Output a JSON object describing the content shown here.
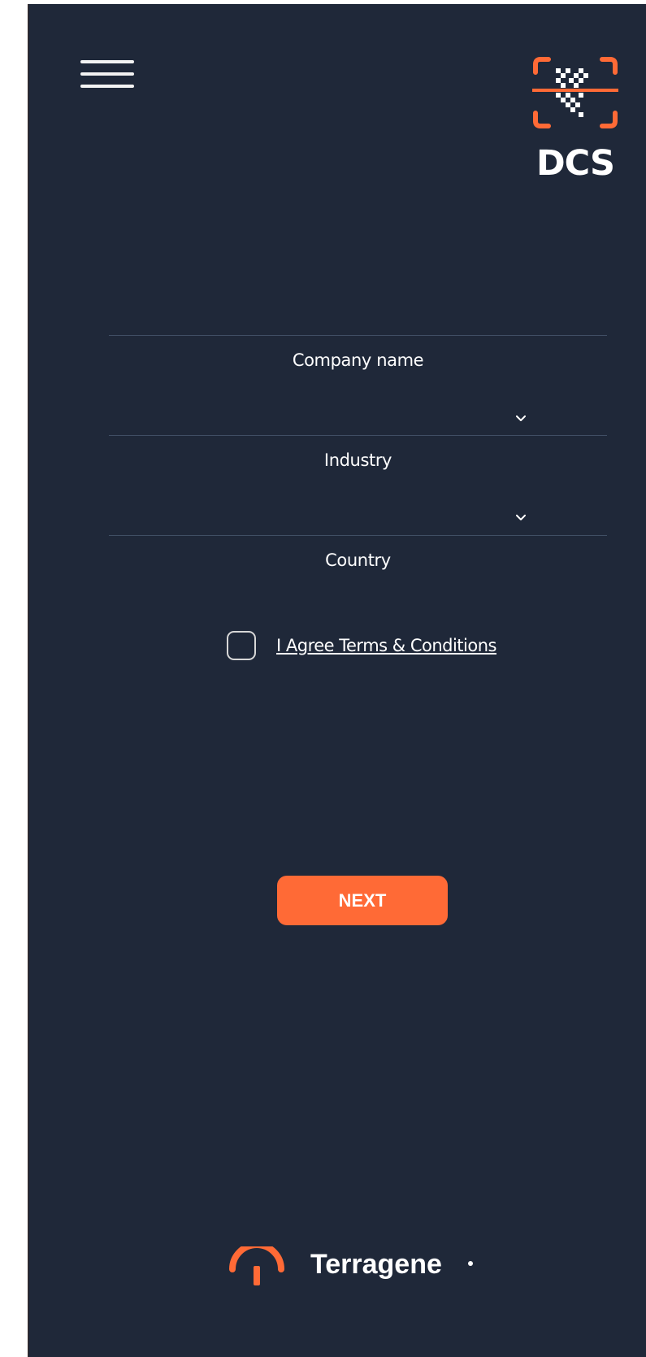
{
  "header": {
    "menu_icon": "hamburger-menu-icon",
    "app_logo_text": "DCS",
    "app_logo_icon": "qr-scan-icon"
  },
  "form": {
    "company_name_label": "Company name",
    "industry_label": "Industry",
    "country_label": "Country",
    "dropdown_icon": "chevron-down-icon",
    "agree_label": "I Agree Terms & Conditions",
    "next_button_label": "NEXT"
  },
  "footer": {
    "brand": "Terragene"
  },
  "colors": {
    "background": "#1f2839",
    "accent": "#ff6a36",
    "text": "#ffffff",
    "divider": "#415066"
  }
}
